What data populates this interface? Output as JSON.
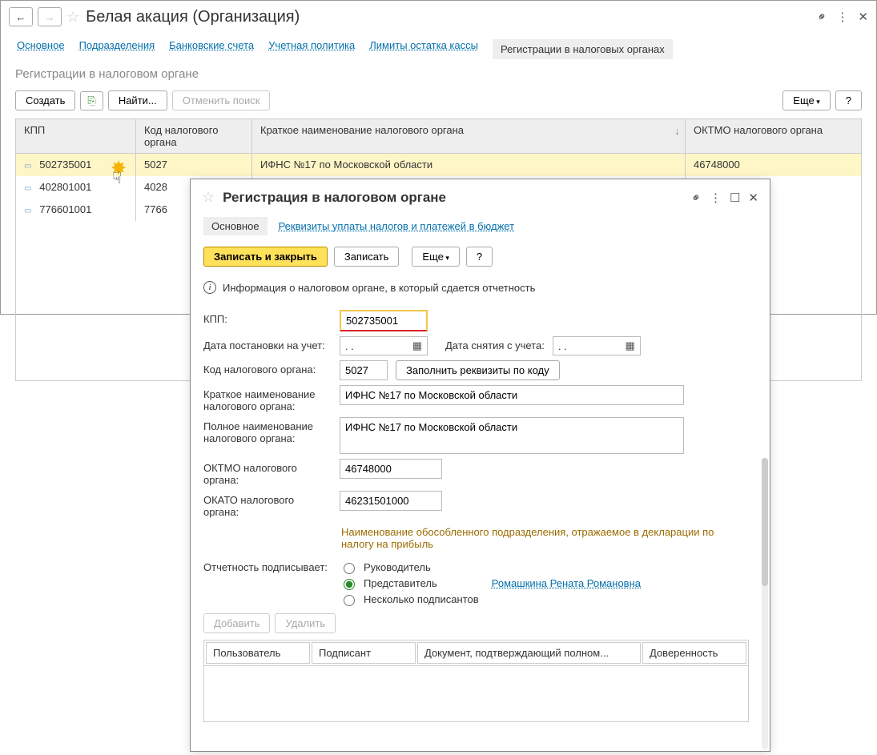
{
  "header": {
    "title": "Белая акация (Организация)",
    "tabs": {
      "main": "Основное",
      "departments": "Подразделения",
      "bank": "Банковские счета",
      "policy": "Учетная политика",
      "limits": "Лимиты остатка кассы",
      "registrations": "Регистрации в налоговых органах"
    }
  },
  "section_title": "Регистрации в налоговом органе",
  "toolbar": {
    "create": "Создать",
    "find": "Найти...",
    "cancel_search": "Отменить поиск",
    "more": "Еще",
    "help": "?"
  },
  "table": {
    "cols": {
      "kpp": "КПП",
      "code": "Код налогового органа",
      "short_name": "Краткое наименование налогового органа",
      "oktmo": "ОКТМО налогового органа"
    },
    "rows": [
      {
        "kpp": "502735001",
        "code": "5027",
        "short_name": "ИФНС №17 по Московской области",
        "oktmo": "46748000"
      },
      {
        "kpp": "402801001",
        "code": "4028",
        "short_name": "",
        "oktmo": ""
      },
      {
        "kpp": "776601001",
        "code": "7766",
        "short_name": "",
        "oktmo": ""
      }
    ]
  },
  "dialog": {
    "title": "Регистрация в налоговом органе",
    "nav": {
      "main": "Основное",
      "details": "Реквизиты уплаты налогов и платежей в бюджет"
    },
    "toolbar": {
      "save_close": "Записать и закрыть",
      "save": "Записать",
      "more": "Еще",
      "help": "?"
    },
    "info": "Информация о налоговом органе, в который сдается отчетность",
    "fields": {
      "kpp_label": "КПП:",
      "kpp_value": "502735001",
      "reg_date_label": "Дата постановки на учет:",
      "reg_date_value": "  .  .",
      "dereg_date_label": "Дата снятия с учета:",
      "dereg_date_value": "  .  .",
      "code_label": "Код налогового органа:",
      "code_value": "5027",
      "fill_btn": "Заполнить реквизиты по коду",
      "short_label": "Краткое наименование налогового органа:",
      "short_value": "ИФНС №17 по Московской области",
      "full_label": "Полное наименование налогового органа:",
      "full_value": "ИФНС №17 по Московской области",
      "oktmo_label": "ОКТМО налогового органа:",
      "oktmo_value": "46748000",
      "okato_label": "ОКАТО налогового органа:",
      "okato_value": "46231501000",
      "note": "Наименование обособленного подразделения, отражаемое в декларации по налогу на прибыль",
      "signer_label": "Отчетность подписывает:",
      "signer_opts": {
        "head": "Руководитель",
        "rep": "Представитель",
        "many": "Несколько подписантов"
      },
      "signer_link": "Ромашкина Рената Романовна",
      "add": "Добавить",
      "del": "Удалить",
      "tcols": {
        "user": "Пользователь",
        "signer": "Подписант",
        "doc": "Документ, подтверждающий полном...",
        "auth": "Доверенность"
      }
    }
  }
}
